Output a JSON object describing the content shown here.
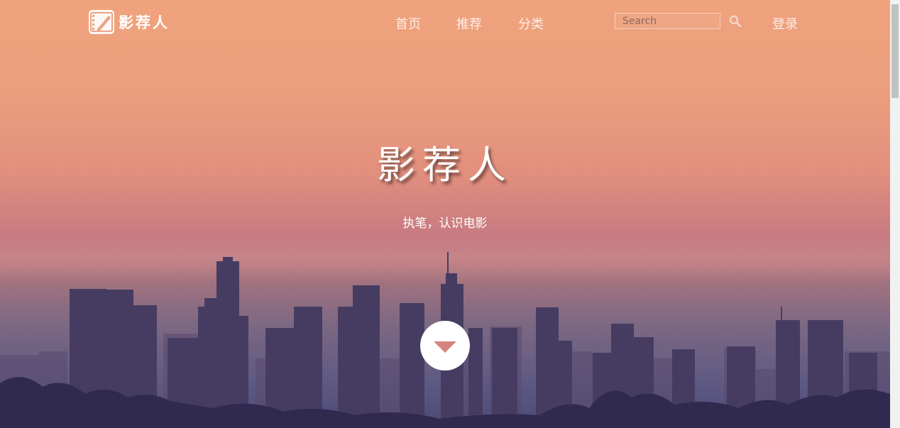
{
  "brand": {
    "name": "影荐人",
    "icon": "film-pen-icon"
  },
  "nav": {
    "items": [
      {
        "label": "首页"
      },
      {
        "label": "推荐"
      },
      {
        "label": "分类"
      }
    ],
    "search_placeholder": "Search",
    "search_icon": "search-icon",
    "login_label": "登录"
  },
  "hero": {
    "title": "影荐人",
    "subtitle": "执笔，认识电影",
    "scroll_icon": "chevron-down-icon"
  },
  "colors": {
    "sky_top": "#f0a27d",
    "sky_bottom": "#4a4a77",
    "arrow": "#d4847c"
  }
}
